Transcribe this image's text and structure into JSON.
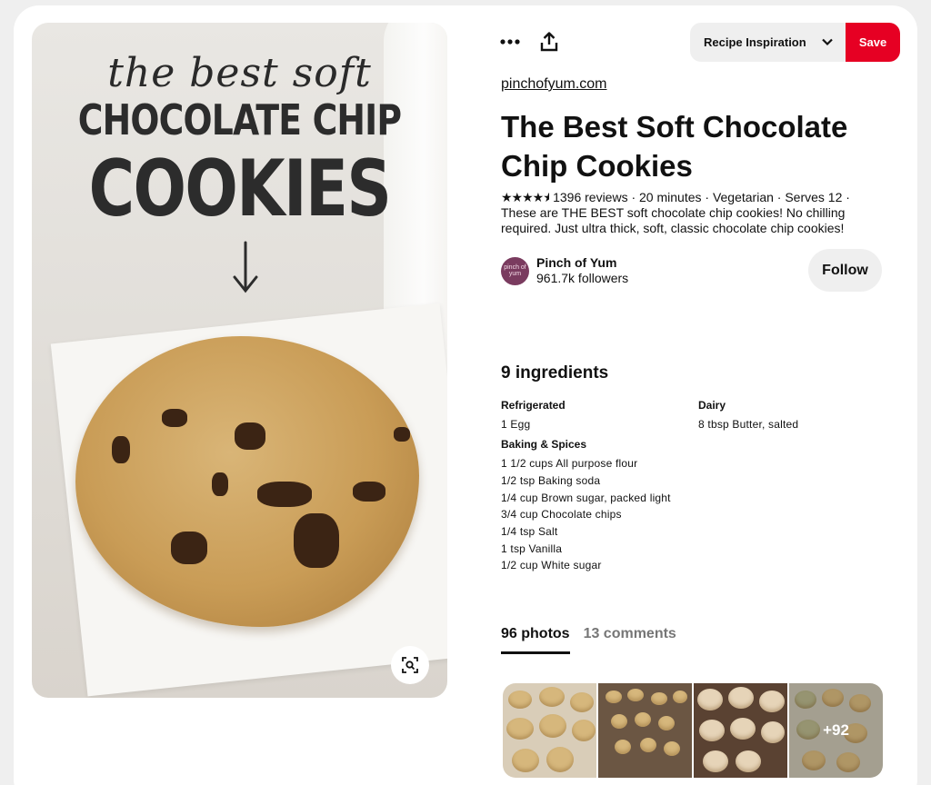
{
  "pin_image": {
    "overlay_script": "the best soft",
    "overlay_line1": "CHOCOLATE CHIP",
    "overlay_line2": "COOKIES",
    "lens_icon": "visual-search-icon"
  },
  "toolbar": {
    "more_icon": "more-dots-icon",
    "share_icon": "share-upload-icon",
    "board_select": "Recipe Inspiration",
    "save_label": "Save"
  },
  "pin": {
    "source": "pinchofyum.com",
    "title": "The Best Soft Chocolate Chip Cookies",
    "rating_stars": 4.5,
    "meta_line": "1396 reviews · 20 minutes · Vegetarian · Serves 12 ·",
    "description": "These are THE BEST soft chocolate chip cookies! No chilling required. Just ultra thick, soft, classic chocolate chip cookies!"
  },
  "creator": {
    "avatar_text": "pinch of yum",
    "name": "Pinch of Yum",
    "followers": "961.7k followers",
    "follow_label": "Follow"
  },
  "ingredients": {
    "heading": "9 ingredients",
    "groups": [
      {
        "title": "Refrigerated",
        "items": [
          "1 Egg"
        ]
      },
      {
        "title": "Baking & Spices",
        "items": [
          "1 1/2 cups All purpose flour",
          "1/2 tsp Baking soda",
          "1/4 cup Brown sugar, packed light",
          "3/4 cup Chocolate chips",
          "1/4 tsp Salt",
          "1 tsp Vanilla",
          "1/2 cup White sugar"
        ]
      },
      {
        "title": "Dairy",
        "items": [
          "8 tbsp Butter, salted"
        ]
      }
    ]
  },
  "tabs": [
    {
      "label": "96 photos",
      "active": true
    },
    {
      "label": "13 comments",
      "active": false
    }
  ],
  "photos": {
    "more_count": "+92"
  },
  "colors": {
    "save_red": "#e60023",
    "button_gray": "#efefef"
  }
}
